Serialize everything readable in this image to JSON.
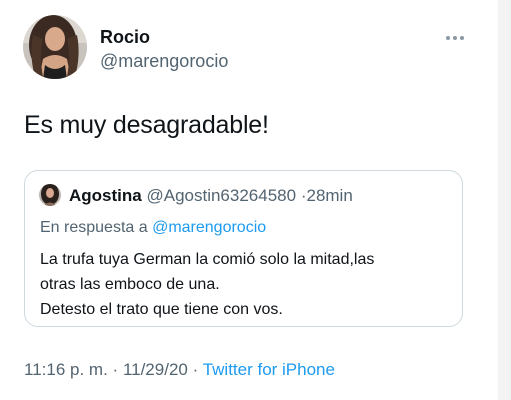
{
  "tweet": {
    "author": {
      "name": "Rocio",
      "handle": "@marengorocio"
    },
    "text": "Es muy desagradable!",
    "time": "11:16 p. m.",
    "date": "11/29/20",
    "separator": "·",
    "source": "Twitter for iPhone"
  },
  "quoted_tweet": {
    "author_name": "Agostina",
    "author_handle": "@Agostin63264580",
    "separator": "·",
    "time_ago": "28min",
    "reply_prefix": "En respuesta a",
    "reply_to": "@marengorocio",
    "text_lines": [
      "La trufa tuya German la comió solo la mitad,las",
      "otras las emboco de una.",
      "Detesto el trato que tiene con vos."
    ]
  },
  "icons": {
    "more": "more-horizontal-icon"
  },
  "colors": {
    "text_primary": "#0f1419",
    "text_secondary": "#536471",
    "link": "#1d9bf0",
    "border": "#cfd9de"
  }
}
